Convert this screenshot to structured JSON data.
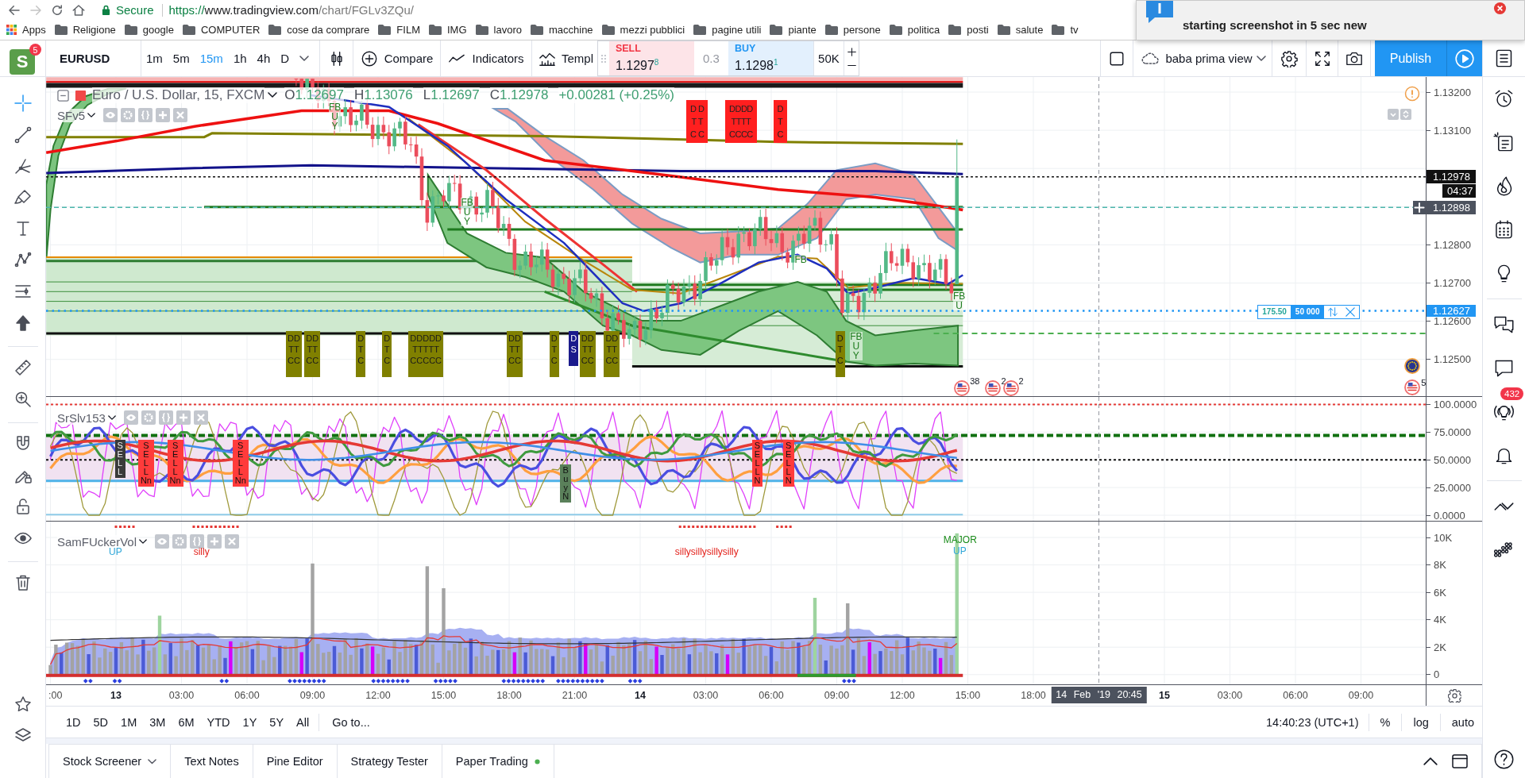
{
  "browser": {
    "secure_label": "Secure",
    "url": {
      "scheme": "https://",
      "host": "www.tradingview.com",
      "path": "/chart/FGLv3ZQu/"
    },
    "apps_label": "Apps",
    "bookmarks": [
      "Religione",
      "google",
      "COMPUTER",
      "cose da comprare",
      "FILM",
      "IMG",
      "lavoro",
      "macchine",
      "mezzi pubblici",
      "pagine utili",
      "piante",
      "persone",
      "politica",
      "posti",
      "salute",
      "tv"
    ]
  },
  "notification": {
    "text": "starting screenshot in 5 sec new"
  },
  "logo": {
    "letter": "S",
    "badge": "5"
  },
  "left_toolbar": {
    "tools": [
      {
        "selected": true
      },
      {
        "selected": false
      },
      {
        "selected": false
      },
      {
        "selected": false
      },
      {
        "selected": false
      },
      {
        "selected": false
      },
      {
        "selected": false
      },
      {
        "selected": false
      },
      {
        "selected": false
      },
      {
        "selected": false
      },
      {
        "selected": false
      },
      {
        "selected": false
      },
      {
        "selected": false
      },
      {
        "selected": false
      },
      {
        "selected": false
      }
    ]
  },
  "header": {
    "symbol": "EURUSD",
    "intervals": [
      {
        "label": "1m",
        "selected": false
      },
      {
        "label": "5m",
        "selected": false
      },
      {
        "label": "15m",
        "selected": true
      },
      {
        "label": "1h",
        "selected": false
      },
      {
        "label": "4h",
        "selected": false
      },
      {
        "label": "D",
        "selected": false
      }
    ],
    "compare": "Compare",
    "indicators": "Indicators",
    "templates": "Templ",
    "trade": {
      "sell": {
        "label": "SELL",
        "price": "1.1297$^{8}$"
      },
      "spread": "0.3",
      "buy": {
        "label": "BUY",
        "price": "1.1298$^{1}$"
      },
      "quantity": "50K"
    },
    "layout_name": "baba prima view",
    "publish": "Publish"
  },
  "main_pane": {
    "legend": {
      "title": "Euro / U.S. Dollar, 15, FXCM",
      "ohlc": [
        {
          "label": "O",
          "value": "1.12697"
        },
        {
          "label": "H",
          "value": "1.13076"
        },
        {
          "label": "L",
          "value": "1.12697"
        },
        {
          "label": "C",
          "value": "1.12978"
        }
      ],
      "change": "+0.00281 (+0.25%)"
    },
    "indicator": "SFv5",
    "top_markers": [
      {
        "lines": [
          "D D",
          "T T",
          "C C"
        ]
      },
      {
        "lines": [
          "DDDD",
          "TTTT",
          "CCCC"
        ]
      },
      {
        "lines": [
          "D",
          "T",
          "C"
        ]
      }
    ],
    "bottom_markers": [
      {
        "lines": [
          "DD",
          "TT",
          "CC"
        ],
        "color": "#808000"
      },
      {
        "lines": [
          "DD",
          "TT",
          "CC"
        ],
        "color": "#808000"
      },
      {
        "lines": [
          "D",
          "T",
          "C"
        ],
        "color": "#808000"
      },
      {
        "lines": [
          "D",
          "T",
          "C"
        ],
        "color": "#808000"
      },
      {
        "lines": [
          "DDDDD",
          "TTTTT",
          "CCCCC"
        ],
        "color": "#808000"
      },
      {
        "lines": [
          "DD",
          "TT",
          "CC"
        ],
        "color": "#808000"
      },
      {
        "lines": [
          "D",
          "T",
          "C"
        ],
        "color": "#808000"
      },
      {
        "lines": [
          "D",
          "S"
        ],
        "color": "#1a1a8c"
      },
      {
        "lines": [
          "DD",
          "TT",
          "CC"
        ],
        "color": "#808000"
      },
      {
        "lines": [
          "DD",
          "TT",
          "CC"
        ],
        "color": "#808000"
      },
      {
        "lines": [
          "D",
          "T",
          "C"
        ],
        "color": "#808000"
      }
    ],
    "signals": [
      {
        "lines": [
          "FB",
          "U",
          "Y"
        ]
      },
      {
        "lines": [
          "FB",
          "U",
          "Y"
        ]
      },
      {
        "lines": [
          "FB"
        ]
      },
      {
        "lines": [
          "FB",
          "U",
          "Y"
        ]
      },
      {
        "lines": [
          "FB",
          "U"
        ]
      }
    ],
    "events": [
      {
        "kind": "us",
        "count": "38"
      },
      {
        "kind": "us",
        "count": "2"
      },
      {
        "kind": "us",
        "count": "2"
      }
    ],
    "position": {
      "pnl": "175.50",
      "quantity": "50 000"
    },
    "axis": {
      "labels": [
        "1.13200",
        "1.13100",
        "1.12800",
        "1.12700",
        "1.12600",
        "1.12500"
      ],
      "last_price": "1.12978",
      "countdown": "04:37",
      "crosshair_price": "1.12898",
      "order_price": "1.12627"
    },
    "axis_events": [
      {
        "kind": "eu"
      },
      {
        "kind": "us",
        "count": "5"
      }
    ]
  },
  "oscillator_pane": {
    "indicator": "SrSlv153",
    "markers": [
      {
        "lines": [
          "S",
          "E",
          "L",
          "L"
        ],
        "color": "#3a3a3a"
      },
      {
        "lines": [
          "S",
          "E",
          "L",
          "L",
          "Nn"
        ],
        "color": "#ff3b3b"
      },
      {
        "lines": [
          "S",
          "E",
          "L",
          "L",
          "Nn"
        ],
        "color": "#ff3b3b"
      },
      {
        "lines": [
          "S",
          "E",
          "L",
          "L",
          "Nn"
        ],
        "color": "#ff3b3b"
      },
      {
        "lines": [
          "B",
          "u",
          "y",
          "N"
        ],
        "color": "#5a805a"
      },
      {
        "lines": [
          "S",
          "E",
          "L",
          "L",
          "N"
        ],
        "color": "#ff3b3b"
      },
      {
        "lines": [
          "S",
          "E",
          "L",
          "L",
          "N"
        ],
        "color": "#ff3b3b"
      }
    ],
    "axis": {
      "labels": [
        "100.0000",
        "75.0000",
        "50.0000",
        "25.0000",
        "0.0000"
      ]
    }
  },
  "volume_pane": {
    "indicator": "SamFUckerVol",
    "labels": [
      {
        "text": "UP",
        "color": "#2ea6d8"
      },
      {
        "text": "silly",
        "color": "#e3211b"
      },
      {
        "text": "sillysillysillysilly",
        "color": "#e3211b"
      },
      {
        "text": "MAJOR",
        "color": "#1b8c1b"
      },
      {
        "text": "UP",
        "color": "#2ea6d8"
      }
    ],
    "axis": {
      "labels": [
        "10K",
        "8K",
        "6K",
        "4K",
        "2K",
        "0"
      ]
    }
  },
  "time_axis": {
    "labels": [
      {
        "text": ":00",
        "kind": "time"
      },
      {
        "text": "13",
        "kind": "day"
      },
      {
        "text": "03:00",
        "kind": "time"
      },
      {
        "text": "06:00",
        "kind": "time"
      },
      {
        "text": "09:00",
        "kind": "time"
      },
      {
        "text": "12:00",
        "kind": "time"
      },
      {
        "text": "15:00",
        "kind": "time"
      },
      {
        "text": "18:00",
        "kind": "time"
      },
      {
        "text": "21:00",
        "kind": "time"
      },
      {
        "text": "14",
        "kind": "day"
      },
      {
        "text": "03:00",
        "kind": "time"
      },
      {
        "text": "06:00",
        "kind": "time"
      },
      {
        "text": "09:00",
        "kind": "time"
      },
      {
        "text": "12:00",
        "kind": "time"
      },
      {
        "text": "15:00",
        "kind": "time"
      },
      {
        "text": "18:00",
        "kind": "time"
      },
      {
        "text": "15",
        "kind": "day"
      },
      {
        "text": "03:00",
        "kind": "time"
      },
      {
        "text": "06:00",
        "kind": "time"
      },
      {
        "text": "09:00",
        "kind": "time"
      }
    ],
    "crosshair_label": "14 Feb '19 20:45"
  },
  "range_bar": {
    "ranges": [
      {
        "label": "1D",
        "selected": false
      },
      {
        "label": "5D",
        "selected": false
      },
      {
        "label": "1M",
        "selected": false
      },
      {
        "label": "3M",
        "selected": false
      },
      {
        "label": "6M",
        "selected": false
      },
      {
        "label": "YTD",
        "selected": false
      },
      {
        "label": "1Y",
        "selected": false
      },
      {
        "label": "5Y",
        "selected": false
      },
      {
        "label": "All",
        "selected": false
      }
    ],
    "goto": "Go to...",
    "clock": "14:40:23 (UTC+1)",
    "scale_options": [
      "%",
      "log",
      "auto"
    ]
  },
  "footer": {
    "tabs": [
      {
        "label": "Stock Screener",
        "selected": false
      },
      {
        "label": "Text Notes",
        "selected": false
      },
      {
        "label": "Pine Editor",
        "selected": false
      },
      {
        "label": "Strategy Tester",
        "selected": false
      },
      {
        "label": "Paper Trading",
        "selected": false
      }
    ]
  },
  "right_sidebar": {
    "ideas_badge": "432"
  }
}
